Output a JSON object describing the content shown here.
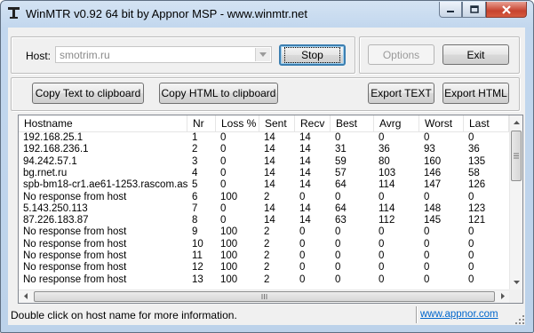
{
  "window": {
    "title": "WinMTR v0.92 64 bit by Appnor MSP - www.winmtr.net",
    "app_icon": "network-tower-icon",
    "controls": [
      "minimize-icon",
      "maximize-icon",
      "close-icon"
    ]
  },
  "host_group": {
    "label": "Host:",
    "value": "smotrim.ru",
    "stop_button": "Stop"
  },
  "side_buttons": {
    "options": "Options",
    "exit": "Exit"
  },
  "export_buttons": {
    "copy_text": "Copy Text to clipboard",
    "copy_html": "Copy HTML to clipboard",
    "export_text": "Export TEXT",
    "export_html": "Export HTML"
  },
  "table": {
    "columns": [
      "Hostname",
      "Nr",
      "Loss %",
      "Sent",
      "Recv",
      "Best",
      "Avrg",
      "Worst",
      "Last"
    ],
    "rows": [
      [
        "192.168.25.1",
        "1",
        "0",
        "14",
        "14",
        "0",
        "0",
        "0",
        "0"
      ],
      [
        "192.168.236.1",
        "2",
        "0",
        "14",
        "14",
        "31",
        "36",
        "93",
        "36"
      ],
      [
        "94.242.57.1",
        "3",
        "0",
        "14",
        "14",
        "59",
        "80",
        "160",
        "135"
      ],
      [
        "bg.rnet.ru",
        "4",
        "0",
        "14",
        "14",
        "57",
        "103",
        "146",
        "58"
      ],
      [
        "spb-bm18-cr1.ae61-1253.rascom.as2...",
        "5",
        "0",
        "14",
        "14",
        "64",
        "114",
        "147",
        "126"
      ],
      [
        "No response from host",
        "6",
        "100",
        "2",
        "0",
        "0",
        "0",
        "0",
        "0"
      ],
      [
        "5.143.250.113",
        "7",
        "0",
        "14",
        "14",
        "64",
        "114",
        "148",
        "123"
      ],
      [
        "87.226.183.87",
        "8",
        "0",
        "14",
        "14",
        "63",
        "112",
        "145",
        "121"
      ],
      [
        "No response from host",
        "9",
        "100",
        "2",
        "0",
        "0",
        "0",
        "0",
        "0"
      ],
      [
        "No response from host",
        "10",
        "100",
        "2",
        "0",
        "0",
        "0",
        "0",
        "0"
      ],
      [
        "No response from host",
        "11",
        "100",
        "2",
        "0",
        "0",
        "0",
        "0",
        "0"
      ],
      [
        "No response from host",
        "12",
        "100",
        "2",
        "0",
        "0",
        "0",
        "0",
        "0"
      ],
      [
        "No response from host",
        "13",
        "100",
        "2",
        "0",
        "0",
        "0",
        "0",
        "0"
      ]
    ]
  },
  "status_bar": {
    "message": "Double click on host name for more information.",
    "link": "www.appnor.com"
  },
  "colors": {
    "title_bar": "#c2d7ee",
    "close_button": "#c7432f",
    "link": "#0066cc",
    "default_button_border": "#3c7fb1"
  }
}
